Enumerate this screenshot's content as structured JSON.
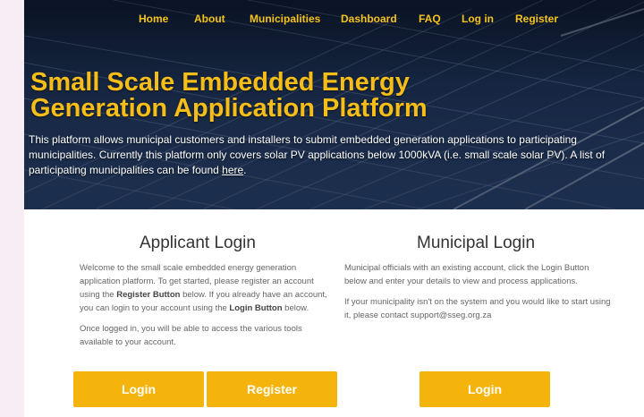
{
  "nav": {
    "items": [
      "Home",
      "About",
      "Municipalities",
      "Dashboard",
      "FAQ",
      "Log in",
      "Register"
    ]
  },
  "hero": {
    "title_line1": "Small Scale Embedded Energy",
    "title_line2": "Generation Application Platform",
    "description_before_link": "This platform allows municipal customers and installers to submit embedded generation applications to participating municipalities. Currently this platform only covers solar PV applications below 1000kVA (i.e. small scale solar PV). A list of participating municipalities can be found ",
    "description_link": "here",
    "description_after_link": "."
  },
  "applicant": {
    "title": "Applicant Login",
    "p1_a": "Welcome to the small scale embedded energy generation application platform. To get started, please register an account using the ",
    "p1_b": "Register Button",
    "p1_c": " below. If you already have an account, you can login to your account using the ",
    "p1_d": "Login Button",
    "p1_e": " below.",
    "p2": "Once logged in, you will be able to access the various tools available to your account.",
    "login_label": "Login",
    "register_label": "Register"
  },
  "municipal": {
    "title": "Municipal Login",
    "p1": "Municipal officials with an existing account, click the Login Button below and enter your details to view and process applications.",
    "p2": "If your municipality isn't on the system and you would like to start using it, please contact support@sseg.org.za",
    "login_label": "Login"
  },
  "colors": {
    "accent": "#f5b40c",
    "nav_text": "#f5c21b",
    "hero_title": "#f5bd18"
  }
}
